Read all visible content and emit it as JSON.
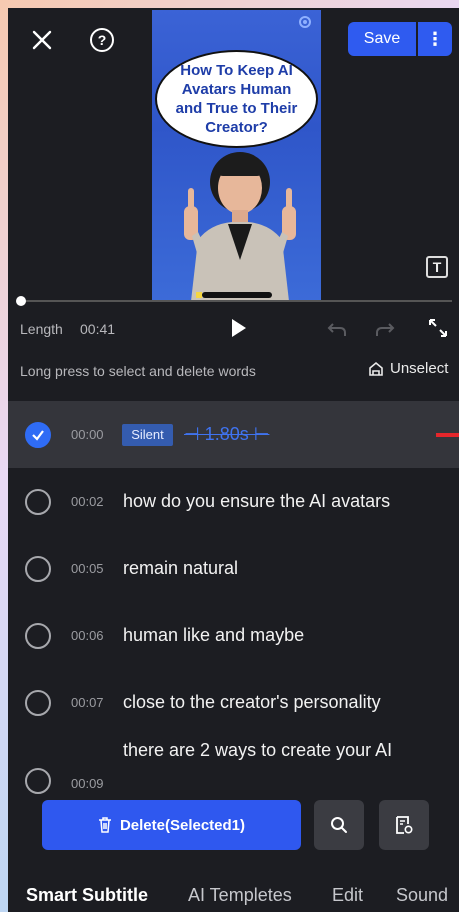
{
  "header": {
    "save_label": "Save"
  },
  "video": {
    "bubble_text": "How To Keep AI Avatars Human and True to Their Creator?"
  },
  "player": {
    "length_label": "Length",
    "length_value": "00:41"
  },
  "hint": {
    "text": "Long press to select and delete words",
    "unselect_label": "Unselect"
  },
  "rows": [
    {
      "time": "00:00",
      "badge": "Silent",
      "duration": "⊣ 1.80s ⊢",
      "selected": true
    },
    {
      "time": "00:02",
      "text": "how do you ensure the AI avatars"
    },
    {
      "time": "00:05",
      "text": "remain natural"
    },
    {
      "time": "00:06",
      "text": "human like and maybe"
    },
    {
      "time": "00:07",
      "text": "close to the creator's personality"
    },
    {
      "time": "00:09",
      "text": "there are 2 ways to create your AI"
    }
  ],
  "actions": {
    "delete_label": "Delete(Selected1)"
  },
  "tabs": [
    {
      "label": "Smart Subtitle",
      "active": true
    },
    {
      "label": "AI Templetes"
    },
    {
      "label": "Edit"
    },
    {
      "label": "Sound"
    }
  ],
  "colors": {
    "accent": "#2f58ef",
    "background": "#1c1d22",
    "selected_row": "#34353b",
    "marker": "#e5262b"
  }
}
